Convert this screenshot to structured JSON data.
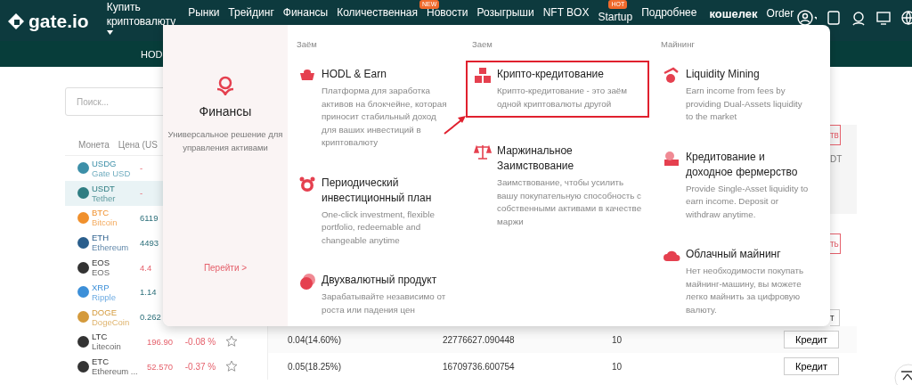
{
  "header": {
    "logo": "gate.io",
    "buy_menu": "Купить криптовалюту",
    "nav": [
      {
        "label": "Рынки"
      },
      {
        "label": "Трейдинг"
      },
      {
        "label": "Финансы"
      },
      {
        "label": "Количественная"
      },
      {
        "label": "Новости",
        "badge": "NEW"
      },
      {
        "label": "Розыгрыши"
      },
      {
        "label": "NFT BOX"
      },
      {
        "label": "Startup",
        "badge": "HOT"
      },
      {
        "label": "Подробнее"
      }
    ],
    "wallet": "кошелек",
    "order": "Order"
  },
  "subnav": [
    "HOD"
  ],
  "search": {
    "placeholder": "Поиск..."
  },
  "coin_columns": [
    "Монета",
    "Цена (US"
  ],
  "coins": [
    {
      "symbol": "USDG",
      "name": "Gate USD",
      "color": "#3c8fa8",
      "price": "-",
      "falling": true,
      "selected": false
    },
    {
      "symbol": "USDT",
      "name": "Tether",
      "color": "#2f7d82",
      "price": "-",
      "falling": true,
      "selected": true
    },
    {
      "symbol": "BTC",
      "name": "Bitcoin",
      "color": "#f0902c",
      "price": "6119",
      "falling": false,
      "selected": false
    },
    {
      "symbol": "ETH",
      "name": "Ethereum",
      "color": "#2a5e8c",
      "price": "4493",
      "falling": false,
      "selected": false
    },
    {
      "symbol": "EOS",
      "name": "EOS",
      "color": "#333333",
      "price": "4.4",
      "falling": true,
      "selected": false
    },
    {
      "symbol": "XRP",
      "name": "Ripple",
      "color": "#3c8fd8",
      "price": "1.14",
      "falling": false,
      "selected": false
    },
    {
      "symbol": "DOGE",
      "name": "DogeCoin",
      "color": "#d49a3c",
      "price": "0.262",
      "falling": false,
      "selected": false
    },
    {
      "symbol": "LTC",
      "name": "Litecoin",
      "color": "#333333",
      "price": "196.90",
      "change": "-0.08 %",
      "falling": true,
      "selected": false
    },
    {
      "symbol": "ETC",
      "name": "Ethereum ...",
      "color": "#333333",
      "price": "52.570",
      "change": "-0.37 %",
      "falling": true,
      "selected": false
    }
  ],
  "peek": {
    "buttons": [
      "тв",
      "ть"
    ],
    "note": "DT",
    "row_button": "т"
  },
  "loans": [
    {
      "rate": "0.04(14.60%)",
      "amount": "22776627.090448",
      "days": "10",
      "action": "Кредит"
    },
    {
      "rate": "0.05(18.25%)",
      "amount": "16709736.600754",
      "days": "10",
      "action": "Кредит"
    }
  ],
  "menu": {
    "title": "Финансы",
    "subtitle": "Универсальное решение для управления активами",
    "link": "Перейти >",
    "columns": [
      {
        "heading": "Заём",
        "items": [
          {
            "kind": "ingot",
            "title": "HODL & Earn",
            "desc": "Платформа для заработка активов на блокчейне, которая приносит стабильный доход для ваших инвестиций в криптовалюту",
            "highlighted": false
          },
          {
            "kind": "clock",
            "title": "Периодический инвестиционный план",
            "desc": "One-click investment, flexible portfolio, redeemable and changeable anytime",
            "highlighted": false
          },
          {
            "kind": "coins",
            "title": "Двухвалютный продукт",
            "desc": "Зарабатывайте независимо от роста или падения цен",
            "highlighted": false
          }
        ]
      },
      {
        "heading": "Заем",
        "items": [
          {
            "kind": "cubes",
            "title": "Крипто-кредитование",
            "desc": "Крипто-кредитование - это заём одной криптовалюты другой",
            "highlighted": true
          },
          {
            "kind": "scales",
            "title": "Маржинальное Заимствование",
            "desc": "Заимствование, чтобы усилить вашу покупательную способность с собственными активами в качестве маржи",
            "highlighted": false
          }
        ]
      },
      {
        "heading": "Майнинг",
        "items": [
          {
            "kind": "pick",
            "title": "Liquidity Mining",
            "desc": "Earn income from fees by providing Dual-Assets liquidity to the market",
            "highlighted": false
          },
          {
            "kind": "farm",
            "title": "Кредитование и доходное фермерство",
            "desc": "Provide Single-Asset liquidity to earn income. Deposit or withdraw anytime.",
            "highlighted": false
          },
          {
            "kind": "cloud",
            "title": "Облачный майнинг",
            "desc": "Нет необходимости покупать майнинг-машину, вы можете легко майнить за цифровую валюту.",
            "highlighted": false
          }
        ]
      }
    ]
  }
}
